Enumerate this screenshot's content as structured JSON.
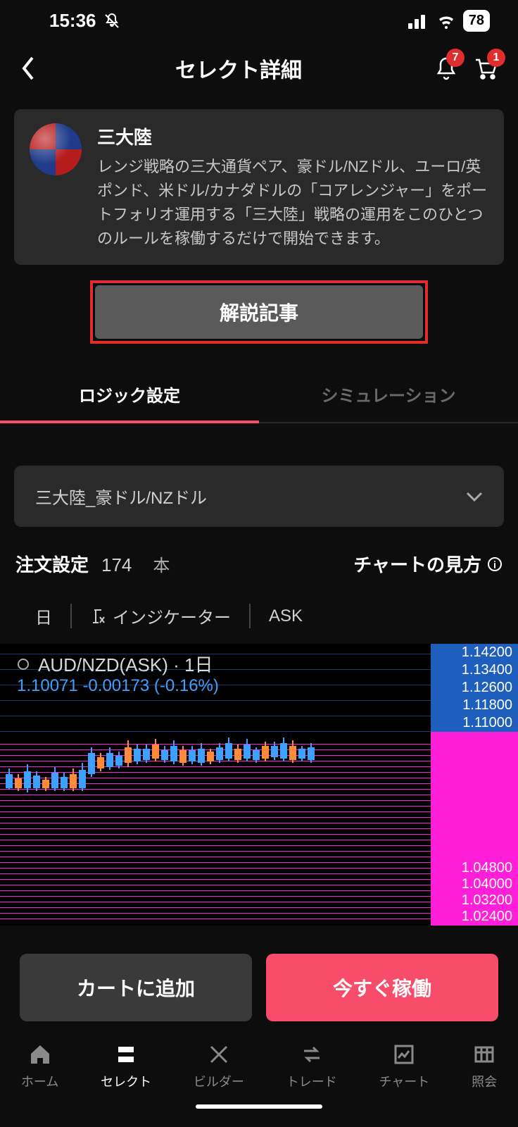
{
  "status": {
    "time": "15:36",
    "battery": "78"
  },
  "header": {
    "title": "セレクト詳細",
    "bell_badge": "7",
    "cart_badge": "1"
  },
  "card": {
    "title": "三大陸",
    "desc": "レンジ戦略の三大通貨ペア、豪ドル/NZドル、ユーロ/英ポンド、米ドル/カナダドルの「コアレンジャー」をポートフォリオ運用する「三大陸」戦略の運用をこのひとつのルールを稼働するだけで開始できます。"
  },
  "big_button": "解説記事",
  "tabs": {
    "logic": "ロジック設定",
    "sim": "シミュレーション"
  },
  "dropdown": {
    "value": "三大陸_豪ドル/NZドル"
  },
  "settings": {
    "label": "注文設定",
    "count": "174",
    "unit": "本",
    "chart_help": "チャートの見方"
  },
  "toolbar": {
    "timeframe": "日",
    "indicator": "インジケーター",
    "price": "ASK"
  },
  "chart": {
    "pair": "AUD/NZD(ASK) · 1日",
    "price": "1.10071",
    "change": "-0.00173",
    "pct": "(-0.16%)",
    "axis_top": [
      "1.14200",
      "1.13400",
      "1.12600",
      "1.11800",
      "1.11000"
    ],
    "axis_bottom": [
      "1.04800",
      "1.04000",
      "1.03200",
      "1.02400"
    ]
  },
  "buttons": {
    "add_cart": "カートに追加",
    "run_now": "今すぐ稼働"
  },
  "nav": {
    "home": "ホーム",
    "select": "セレクト",
    "builder": "ビルダー",
    "trade": "トレード",
    "chart": "チャート",
    "inquiry": "照会"
  },
  "chart_data": {
    "type": "candlestick",
    "pair": "AUD/NZD",
    "timeframe": "1日",
    "price_type": "ASK",
    "last_price": 1.10071,
    "change": -0.00173,
    "change_pct": -0.16,
    "y_range_visible": [
      1.024,
      1.142
    ],
    "approx_ohlc_range": [
      1.06,
      1.11
    ],
    "note": "Candles approximate; many densely-stacked magenta horizontal order lines between ~1.03 and ~1.11; blue gridlines above."
  }
}
